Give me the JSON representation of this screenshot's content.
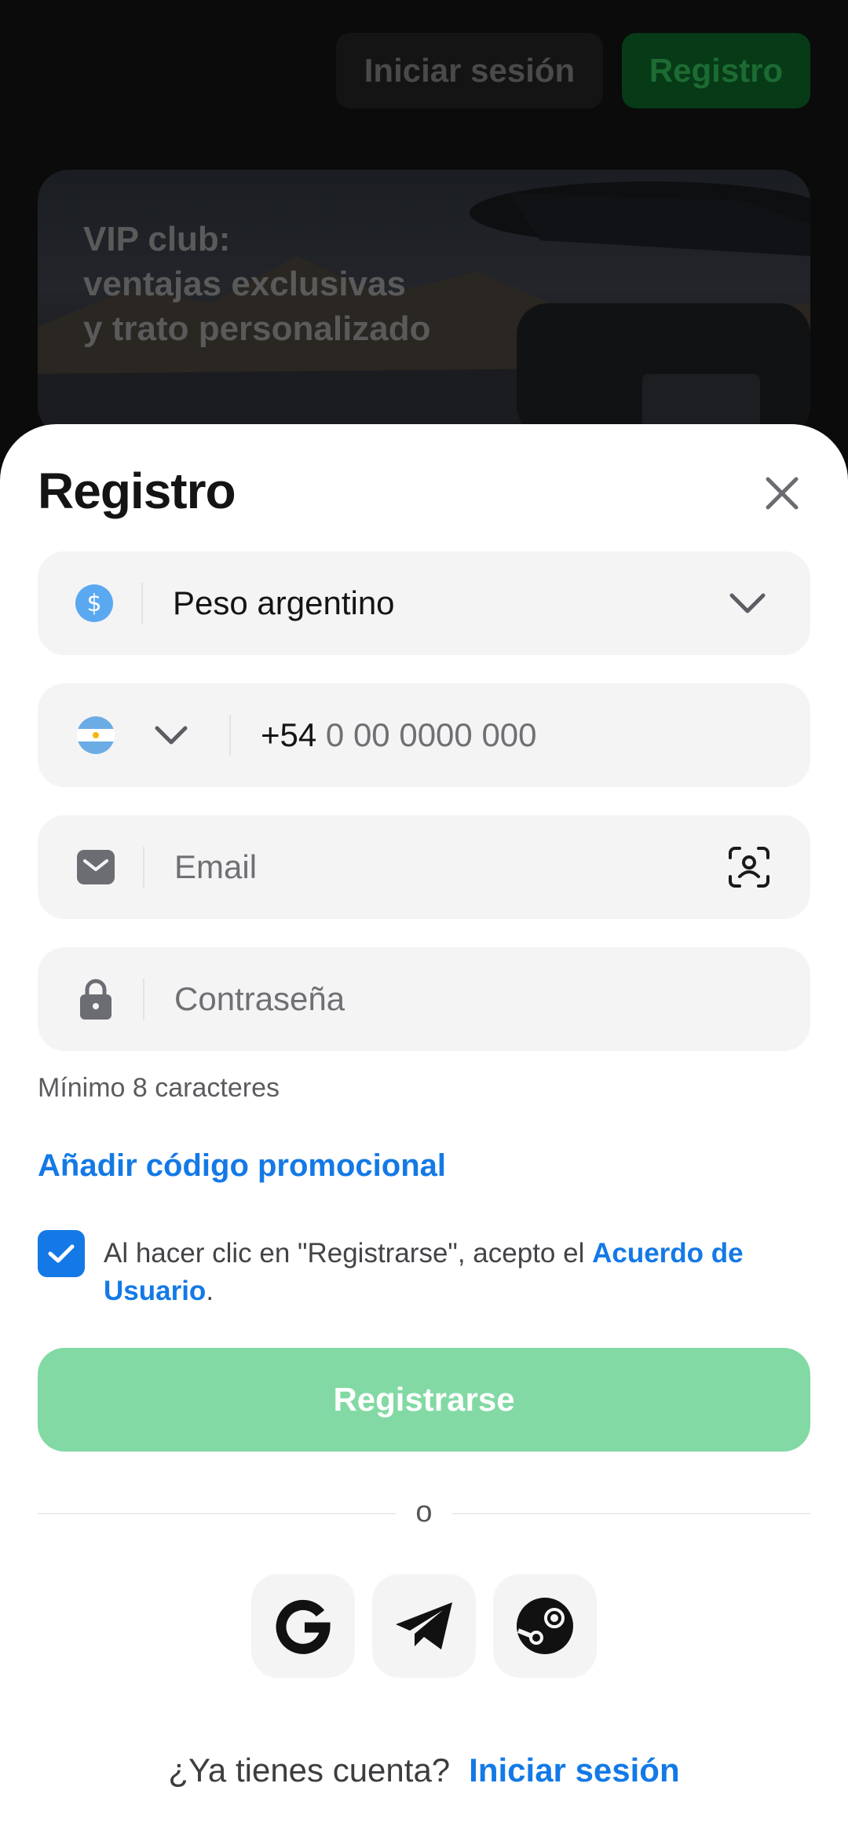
{
  "background": {
    "login_label": "Iniciar sesión",
    "register_label": "Registro",
    "banner_lines": [
      "VIP club:",
      "ventajas exclusivas",
      "y trato personalizado"
    ]
  },
  "sheet": {
    "title": "Registro",
    "currency": {
      "icon": "dollar-coin-icon",
      "value": "Peso argentino"
    },
    "phone": {
      "country_flag": "argentina-flag-icon",
      "prefix": "+54",
      "placeholder": "0 00 0000 000"
    },
    "email": {
      "icon": "envelope-icon",
      "placeholder": "Email",
      "scan_icon": "face-scan-icon"
    },
    "password": {
      "icon": "lock-icon",
      "placeholder": "Contraseña",
      "hint": "Mínimo 8 caracteres"
    },
    "promo_label": "Añadir código promocional",
    "agreement": {
      "checked": true,
      "text": "Al hacer clic en \"Registrarse\", acepto el ",
      "link": "Acuerdo de Usuario",
      "suffix": "."
    },
    "submit_label": "Registrarse",
    "divider_label": "o",
    "social": [
      "google-icon",
      "telegram-icon",
      "steam-icon"
    ],
    "footer": {
      "question": "¿Ya tienes cuenta?",
      "link": "Iniciar sesión"
    }
  },
  "colors": {
    "accent": "#1479e6",
    "submit_disabled": "#82d9a3",
    "field_bg": "#f4f4f5"
  }
}
